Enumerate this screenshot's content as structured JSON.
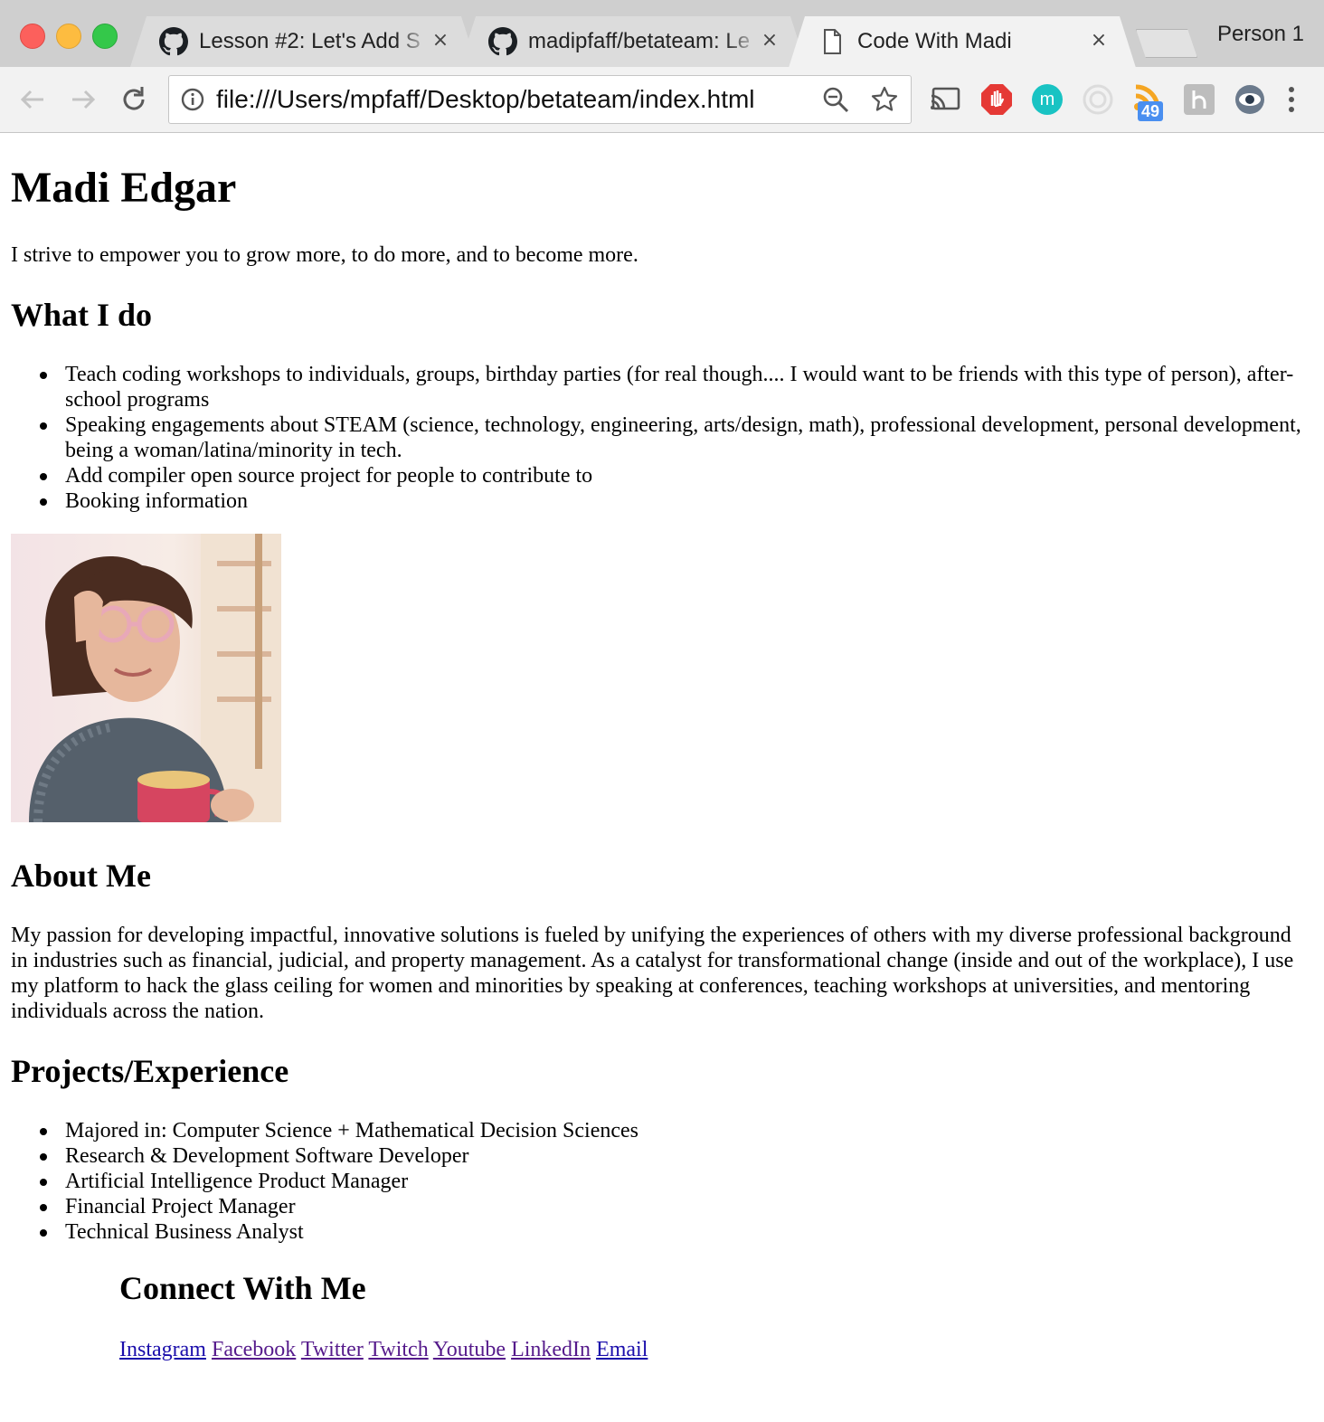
{
  "browser": {
    "tabs": [
      {
        "title": "Lesson #2: Let's Add S",
        "icon": "github-icon",
        "close": "×"
      },
      {
        "title": "madipfaff/betateam: Le",
        "icon": "github-icon",
        "close": "×"
      },
      {
        "title": "Code With Madi",
        "icon": "document-icon",
        "close": "×",
        "active": true
      }
    ],
    "profile": "Person 1",
    "url": "file:///Users/mpfaff/Desktop/betateam/index.html",
    "extension_badge": "49"
  },
  "page": {
    "name": "Madi Edgar",
    "tagline": "I strive to empower you to grow more, to do more, and to become more.",
    "what_i_do": {
      "heading": "What I do",
      "items": [
        "Teach coding workshops to individuals, groups, birthday parties (for real though.... I would want to be friends with this type of person), after-school programs",
        "Speaking engagements about STEAM (science, technology, engineering, arts/design, math), professional development, personal development, being a woman/latina/minority in tech.",
        "Add compiler open source project for people to contribute to",
        "Booking information"
      ]
    },
    "about": {
      "heading": "About Me",
      "text": "My passion for developing impactful, innovative solutions is fueled by unifying the experiences of others with my diverse professional background in industries such as financial, judicial, and property management. As a catalyst for transformational change (inside and out of the workplace), I use my platform to hack the glass ceiling for women and minorities by speaking at conferences, teaching workshops at universities, and mentoring individuals across the nation."
    },
    "projects": {
      "heading": "Projects/Experience",
      "items": [
        "Majored in: Computer Science + Mathematical Decision Sciences",
        "Research & Development Software Developer",
        "Artificial Intelligence Product Manager",
        "Financial Project Manager",
        "Technical Business Analyst"
      ]
    },
    "connect": {
      "heading": "Connect With Me",
      "links": [
        "Instagram",
        "Facebook",
        "Twitter",
        "Twitch",
        "Youtube",
        "LinkedIn",
        "Email"
      ]
    }
  },
  "colors": {
    "link": "#1a0dab",
    "link_visited": "#551a8b"
  }
}
